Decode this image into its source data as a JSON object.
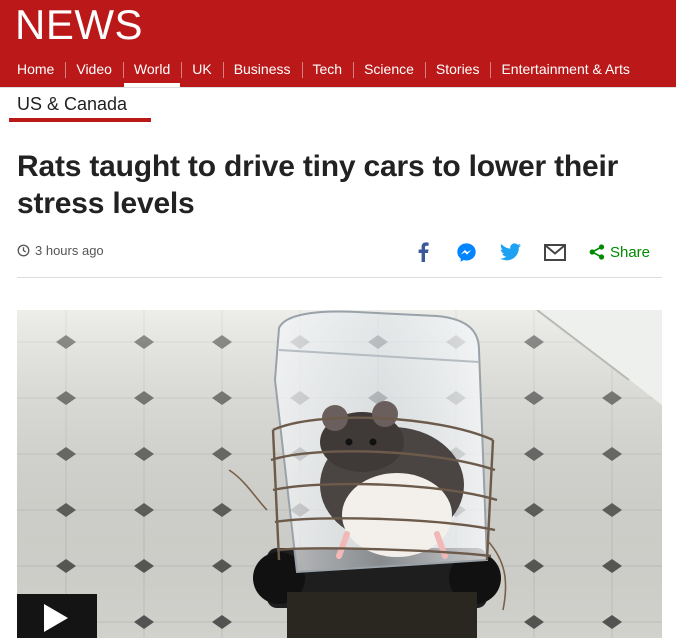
{
  "header": {
    "logo": "NEWS",
    "nav": [
      "Home",
      "Video",
      "World",
      "UK",
      "Business",
      "Tech",
      "Science",
      "Stories",
      "Entertainment & Arts"
    ],
    "active_nav_index": 2
  },
  "section": {
    "title": "US & Canada"
  },
  "article": {
    "headline": "Rats taught to drive tiny cars to lower their stress levels",
    "timestamp": "3 hours ago",
    "share_label": "Share",
    "share_icons": [
      "facebook-icon",
      "messenger-icon",
      "twitter-icon",
      "email-icon",
      "share-icon"
    ]
  },
  "colors": {
    "brand_red": "#bb1919",
    "facebook": "#3b5998",
    "messenger": "#0084ff",
    "twitter": "#1da1f2",
    "share_green": "#008a00"
  }
}
